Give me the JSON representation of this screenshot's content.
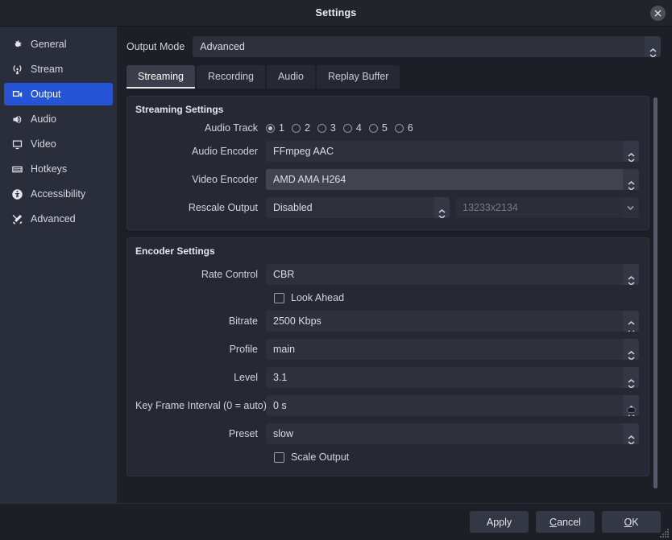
{
  "window": {
    "title": "Settings",
    "close_icon": "close-icon"
  },
  "sidebar": {
    "items": [
      {
        "label": "General",
        "icon": "gear-icon",
        "selected": false
      },
      {
        "label": "Stream",
        "icon": "broadcast-icon",
        "selected": false
      },
      {
        "label": "Output",
        "icon": "output-screen-icon",
        "selected": true
      },
      {
        "label": "Audio",
        "icon": "speaker-icon",
        "selected": false
      },
      {
        "label": "Video",
        "icon": "monitor-icon",
        "selected": false
      },
      {
        "label": "Hotkeys",
        "icon": "keyboard-icon",
        "selected": false
      },
      {
        "label": "Accessibility",
        "icon": "accessibility-icon",
        "selected": false
      },
      {
        "label": "Advanced",
        "icon": "tools-icon",
        "selected": false
      }
    ]
  },
  "output_mode": {
    "label": "Output Mode",
    "value": "Advanced"
  },
  "tabs": [
    {
      "label": "Streaming",
      "active": true
    },
    {
      "label": "Recording",
      "active": false
    },
    {
      "label": "Audio",
      "active": false
    },
    {
      "label": "Replay Buffer",
      "active": false
    }
  ],
  "streaming_settings": {
    "title": "Streaming Settings",
    "audio_track": {
      "label": "Audio Track",
      "options": [
        "1",
        "2",
        "3",
        "4",
        "5",
        "6"
      ],
      "selected": "1"
    },
    "audio_encoder": {
      "label": "Audio Encoder",
      "value": "FFmpeg AAC"
    },
    "video_encoder": {
      "label": "Video Encoder",
      "value": "AMD AMA H264"
    },
    "rescale_output": {
      "label": "Rescale Output",
      "value": "Disabled",
      "resolution_value": "13233x2134",
      "resolution_disabled": true
    }
  },
  "encoder_settings": {
    "title": "Encoder Settings",
    "rate_control": {
      "label": "Rate Control",
      "value": "CBR"
    },
    "look_ahead": {
      "label": "Look Ahead",
      "checked": false
    },
    "bitrate": {
      "label": "Bitrate",
      "value": "2500 Kbps"
    },
    "profile": {
      "label": "Profile",
      "value": "main"
    },
    "level": {
      "label": "Level",
      "value": "3.1"
    },
    "key_frame_interval": {
      "label": "Key Frame Interval (0 = auto)",
      "value": "0 s"
    },
    "preset": {
      "label": "Preset",
      "value": "slow"
    },
    "scale_output": {
      "label": "Scale Output",
      "checked": false
    }
  },
  "footer": {
    "apply": "Apply",
    "cancel_pre": "",
    "cancel_mnemonic": "C",
    "cancel_post": "ancel",
    "ok_mnemonic": "O",
    "ok_post": "K"
  },
  "colors": {
    "accent": "#2555d6",
    "window_bg": "#1d1f27",
    "sidebar_bg": "#2a2d3a",
    "group_bg": "#262934",
    "field_bg": "#2e313c",
    "text": "#d2d5de"
  }
}
